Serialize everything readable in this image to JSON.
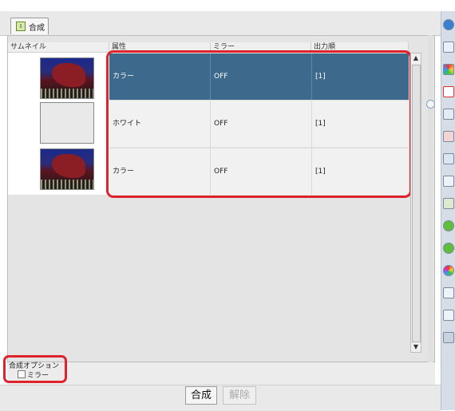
{
  "tab": {
    "label": "合成",
    "icon": "merge-icon"
  },
  "table": {
    "columns": [
      "サムネイル",
      "属性",
      "ミラー",
      "出力順"
    ],
    "rows": [
      {
        "thumb": "image",
        "attr": "カラー",
        "mirror": "OFF",
        "order": "[1]",
        "selected": true
      },
      {
        "thumb": "blank",
        "attr": "ホワイト",
        "mirror": "OFF",
        "order": "[1]",
        "selected": false
      },
      {
        "thumb": "image",
        "attr": "カラー",
        "mirror": "OFF",
        "order": "[1]",
        "selected": false
      }
    ]
  },
  "options": {
    "title": "合成オプション",
    "mirror_label": "ミラー",
    "mirror_checked": false
  },
  "buttons": {
    "merge": "合成",
    "unmerge": "解除",
    "unmerge_enabled": false
  },
  "scrollbar": {
    "up": "▲",
    "down": "▼"
  },
  "colors": {
    "selected_row": "#3d6a8c",
    "highlight": "#e0222c"
  },
  "toolbar_icons": [
    "info-icon",
    "layer-add-icon",
    "color-circle-icon",
    "frame-icon",
    "edit-icon",
    "edit-color-icon",
    "edit-plus-icon",
    "image-window-icon",
    "star-layer-icon",
    "green-down-icon",
    "green-up-icon",
    "color-wheel-icon",
    "copy-icon",
    "duplicate-icon",
    "trash-icon"
  ]
}
